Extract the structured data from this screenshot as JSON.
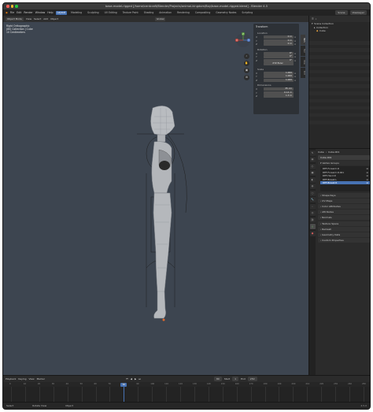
{
  "window": {
    "title": "base-model-rigged [/home/cerdcraft/Blender/Projects/animal-kingdom/Boy/base-model-rigged.blend] - Blender 4.5"
  },
  "menus": [
    "File",
    "Edit",
    "Render",
    "Window",
    "Help"
  ],
  "workspaces": [
    {
      "label": "Layout",
      "active": true
    },
    {
      "label": "Modeling",
      "active": false
    },
    {
      "label": "Sculpting",
      "active": false
    },
    {
      "label": "UV Editing",
      "active": false
    },
    {
      "label": "Texture Paint",
      "active": false
    },
    {
      "label": "Shading",
      "active": false
    },
    {
      "label": "Animation",
      "active": false
    },
    {
      "label": "Rendering",
      "active": false
    },
    {
      "label": "Compositing",
      "active": false
    },
    {
      "label": "Geometry Nodes",
      "active": false
    },
    {
      "label": "Scripting",
      "active": false
    }
  ],
  "topbar_right": {
    "scene": "Scene",
    "view_layer": "ViewLayer"
  },
  "viewport": {
    "mode": "Object Mode",
    "menus": [
      "View",
      "Select",
      "Add",
      "Object"
    ],
    "transform": "Global",
    "overlay_lines": [
      "Right Orthographic",
      "(80) Collection | Cube",
      "10 Centimeters"
    ],
    "gizmo_labels": {
      "x": "X",
      "y": "Y",
      "z": "Z"
    },
    "tool_icons": [
      "zoom-icon",
      "hand-icon",
      "camera-icon",
      "grid-icon"
    ]
  },
  "npanel": {
    "title": "Transform",
    "groups": [
      {
        "label": "Location",
        "rows": [
          {
            "key": "X",
            "value": "0 m"
          },
          {
            "key": "Y",
            "value": "0 m"
          },
          {
            "key": "Z",
            "value": "0 m"
          }
        ]
      },
      {
        "label": "Rotation",
        "rows": [
          {
            "key": "X",
            "value": "0°"
          },
          {
            "key": "Y",
            "value": "0°"
          },
          {
            "key": "Z",
            "value": "0°"
          }
        ]
      },
      {
        "label": "",
        "rows": [
          {
            "key": "",
            "value": "XYZ Euler"
          }
        ]
      },
      {
        "label": "Scale",
        "rows": [
          {
            "key": "X",
            "value": "1.000"
          },
          {
            "key": "Y",
            "value": "1.000"
          },
          {
            "key": "Z",
            "value": "1.000"
          }
        ]
      },
      {
        "label": "Dimensions",
        "rows": [
          {
            "key": "X",
            "value": "35 cm"
          },
          {
            "key": "Y",
            "value": "0.14 m"
          },
          {
            "key": "Z",
            "value": "1.3 m"
          }
        ]
      }
    ],
    "tabs": [
      "Item",
      "Tool",
      "View",
      "Edit"
    ]
  },
  "outliner": {
    "header": "Scene Collection",
    "rows": [
      {
        "icon": "▾",
        "label": "Scene Collection"
      },
      {
        "icon": "▸",
        "label": "Collection"
      },
      {
        "icon": "◆",
        "label": "Cube"
      }
    ]
  },
  "properties": {
    "object_name": "Cube",
    "data_name": "Cube.001",
    "mesh_name": "Cube.001",
    "vertex_groups_title": "Vertex Groups",
    "vertex_groups": [
      {
        "label": "DEF-Forearm.R",
        "selected": false
      },
      {
        "label": "DEF-Forearm.R.001",
        "selected": false
      },
      {
        "label": "DEF-Hand.R",
        "selected": false
      },
      {
        "label": "DEF-Breast.L",
        "selected": false
      },
      {
        "label": "DEF-Breast.R",
        "selected": true
      }
    ],
    "sections": [
      "Shape Keys",
      "UV Maps",
      "Color Attributes",
      "Attributes",
      "Normals",
      "Texture Space",
      "Remesh",
      "Geometry Data",
      "Custom Properties"
    ],
    "tab_icons": [
      "tool-icon",
      "render-icon",
      "output-icon",
      "view-layer-icon",
      "scene-icon",
      "world-icon",
      "object-icon",
      "modifier-icon",
      "particles-icon",
      "physics-icon",
      "constraints-icon",
      "data-icon",
      "material-icon"
    ]
  },
  "timeline": {
    "controls": [
      "Playback",
      "Keying",
      "View",
      "Marker"
    ],
    "current_frame": "80",
    "start_label": "Start",
    "start": "1",
    "end_label": "End",
    "end": "250",
    "ruler": [
      "0",
      "10",
      "20",
      "30",
      "40",
      "50",
      "60",
      "70",
      "80",
      "90",
      "100",
      "110",
      "120",
      "130",
      "140",
      "150",
      "160",
      "170",
      "180",
      "190",
      "200",
      "210",
      "220",
      "230",
      "240",
      "250"
    ]
  },
  "statusbar": {
    "items": [
      "Select",
      "Rotate View",
      "Object"
    ],
    "version": "4.5.0"
  },
  "colors": {
    "accent": "#4772b3",
    "viewport_bg": "#3d4550",
    "vertex_group_selected": "#4772b3"
  }
}
